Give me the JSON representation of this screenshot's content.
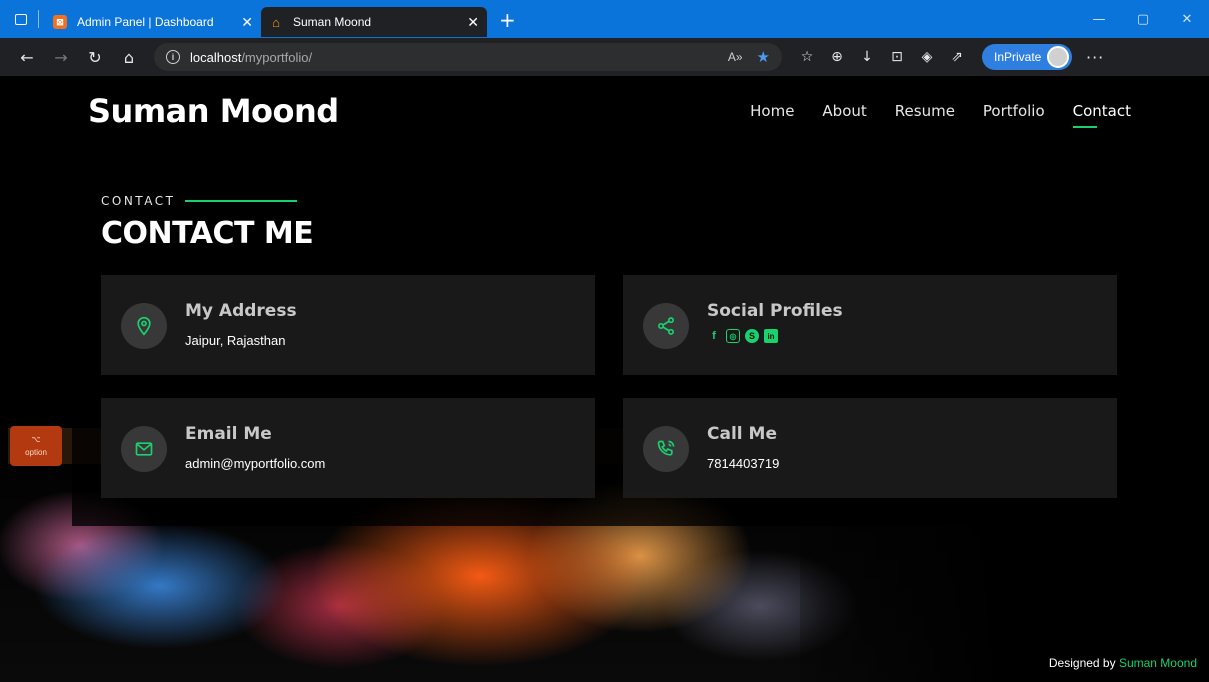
{
  "browser": {
    "tabs": [
      {
        "title": "Admin Panel | Dashboard",
        "active": false
      },
      {
        "title": "Suman Moond",
        "active": true
      }
    ],
    "address": {
      "host": "localhost",
      "path": "/myportfolio/"
    },
    "inprivate_label": "InPrivate"
  },
  "site": {
    "logo": "Suman Moond",
    "menu": [
      "Home",
      "About",
      "Resume",
      "Portfolio",
      "Contact"
    ],
    "active_menu": "Contact"
  },
  "section": {
    "label": "CONTACT",
    "title": "CONTACT ME"
  },
  "cards": {
    "address": {
      "title": "My Address",
      "text": "Jaipur, Rajasthan"
    },
    "social": {
      "title": "Social Profiles",
      "icons": [
        "facebook-icon",
        "instagram-icon",
        "skype-icon",
        "linkedin-icon"
      ]
    },
    "email": {
      "title": "Email Me",
      "text": "admin@myportfolio.com"
    },
    "call": {
      "title": "Call Me",
      "text": "7814403719"
    }
  },
  "background_key_label": "option",
  "footer": {
    "prefix": "Designed by",
    "name": "Suman Moond"
  },
  "colors": {
    "accent": "#18d26e",
    "chrome_blue": "#0b74da"
  }
}
